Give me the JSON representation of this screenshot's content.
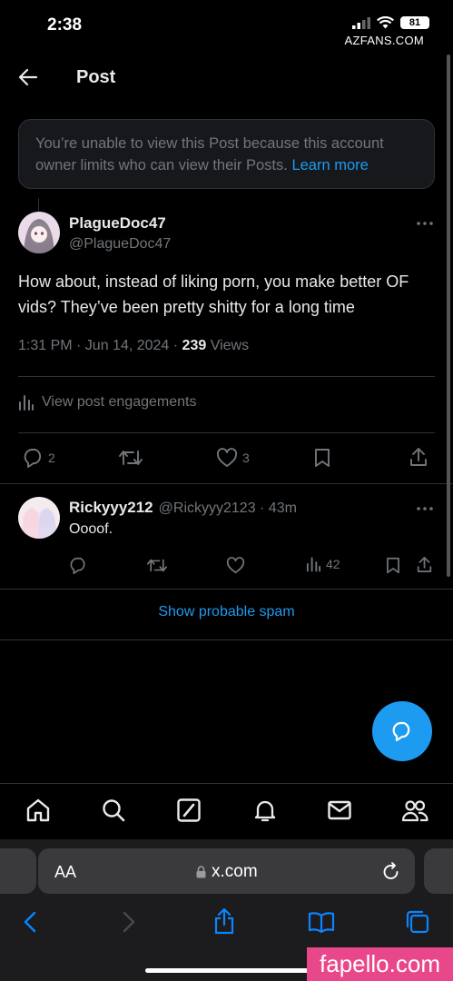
{
  "status_bar": {
    "time": "2:38",
    "battery": "81"
  },
  "watermark_top": "AZFANS.COM",
  "header": {
    "title": "Post"
  },
  "notice": {
    "text": "You’re unable to view this Post because this account owner limits who can view their Posts.",
    "link": "Learn more"
  },
  "post": {
    "name": "PlagueDoc47",
    "handle": "@PlagueDoc47",
    "text": "How about, instead of liking porn, you make better OF vids? They’ve been pretty shitty for a long time",
    "time": "1:31 PM · Jun 14, 2024 · ",
    "views_count": "239",
    "views_label": " Views",
    "engagements": "View post engagements",
    "replies": "2",
    "likes": "3"
  },
  "reply": {
    "name": "Rickyyy212",
    "handle": "@Rickyyy2123 · 43m",
    "text": "Oooof.",
    "views": "42"
  },
  "spam_link": "Show probable spam",
  "browser": {
    "aa": "AA",
    "url": "x.com"
  },
  "watermark_bottom": "fapello.com",
  "colors": {
    "accent": "#1d9bf0",
    "background": "#000000",
    "secondary_text": "#71767b"
  }
}
